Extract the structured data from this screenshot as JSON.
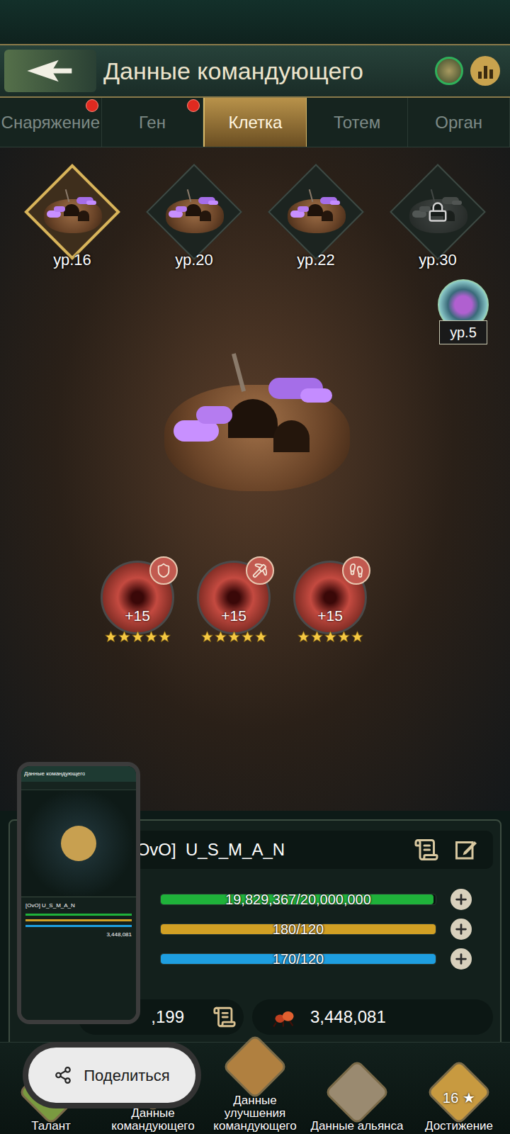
{
  "header": {
    "title": "Данные командующего"
  },
  "tabs": [
    {
      "label": "Снаряжение",
      "selected": false,
      "alert": true
    },
    {
      "label": "Ген",
      "selected": false,
      "alert": true
    },
    {
      "label": "Клетка",
      "selected": true,
      "alert": false
    },
    {
      "label": "Тотем",
      "selected": false,
      "alert": false
    },
    {
      "label": "Орган",
      "selected": false,
      "alert": false
    }
  ],
  "cells": [
    {
      "label": "ур.16",
      "selected": true,
      "locked": false
    },
    {
      "label": "ур.20",
      "selected": false,
      "locked": false
    },
    {
      "label": "ур.22",
      "selected": false,
      "locked": false
    },
    {
      "label": "ур.30",
      "selected": false,
      "locked": true
    }
  ],
  "core_badge": {
    "label": "ур.5"
  },
  "orbs": [
    {
      "label": "+15",
      "stars": 5
    },
    {
      "label": "+15",
      "stars": 5
    },
    {
      "label": "+15",
      "stars": 5
    }
  ],
  "profile": {
    "name": "[OvO]  U_S_M_A_N",
    "bars": [
      {
        "reading": "19,829,367/20,000,000",
        "level": 0.991,
        "color": "#1fb23a"
      },
      {
        "reading": "180/120",
        "level": 1,
        "color": "#d2a024"
      },
      {
        "reading": "170/120",
        "level": 1,
        "color": "#1e9ee0"
      }
    ],
    "stats": [
      {
        "value": ",199"
      },
      {
        "value": "3,448,081"
      }
    ]
  },
  "thumbnail": {
    "title": "Данные командующего",
    "name": "[OvO] U_S_M_A_N",
    "value": "3,448,081"
  },
  "share_button": {
    "label": "Поделиться"
  },
  "nav": [
    {
      "label": "Талант",
      "badge": ""
    },
    {
      "label": "Данные командующего",
      "badge": ""
    },
    {
      "label": "Данные улучшения командующего",
      "badge": ""
    },
    {
      "label": "Данные альянса",
      "badge": ""
    },
    {
      "label": "Достижение",
      "badge": "16 ★"
    }
  ]
}
